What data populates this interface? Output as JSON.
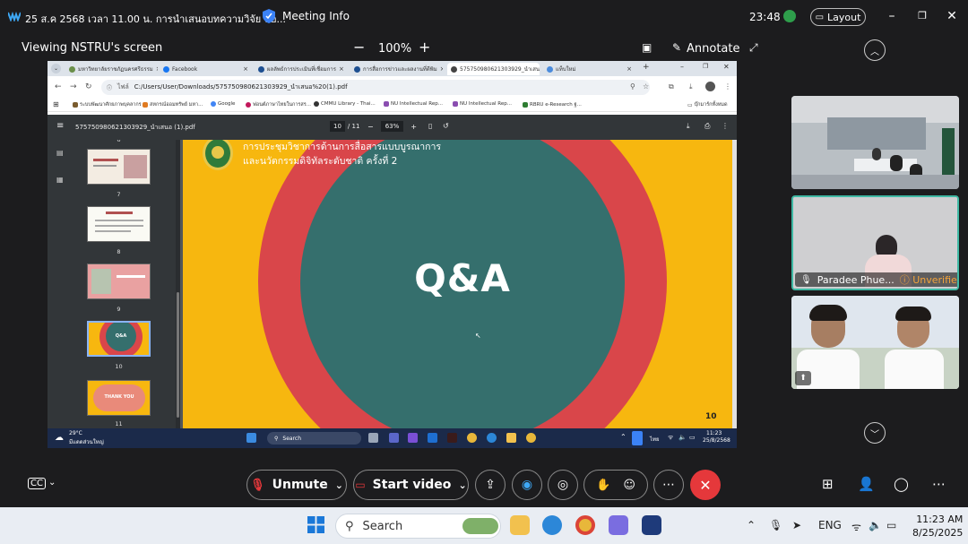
{
  "topbar": {
    "title": "25 ส.ค 2568 เวลา 11.00 น. การนำเสนอบทความวิจัย ห้อ...",
    "meeting_info": "Meeting Info",
    "clock": "23:48",
    "layout": "Layout"
  },
  "sharebar": {
    "label": "Viewing NSTRU's screen",
    "zoom": "100%",
    "annotate": "Annotate"
  },
  "shared": {
    "tabs": [
      {
        "label": "มหาวิทยาลัยราชภัฏนครศรีธรรม"
      },
      {
        "label": "Facebook"
      },
      {
        "label": "ผลลัพธ์การประเมินที่เชื่อมการ"
      },
      {
        "label": "การสื่อการข่าวและผลงานที่ตีพิม"
      },
      {
        "label": "575750980621303929_นำเสน"
      },
      {
        "label": "แท็บใหม่"
      }
    ],
    "url_prefix": "ไฟล์",
    "url": "C:/Users/User/Downloads/575750980621303929_นำเสนอ%20(1).pdf",
    "bookmarks": [
      "ระบบพัฒนาศักยภาพบุคลากร",
      "สหกรณ์ออมทรัพย์ มหา...",
      "Google",
      "ฟอนต์ภาษาไทยในการสร...",
      "CMMU Library - Thai...",
      "NU Intellectual Rep...",
      "NU Intellectual Rep...",
      "RBRU e-Research ฐ..."
    ],
    "bookmarks_all": "บุ๊กมาร์กทั้งหมด",
    "pdf": {
      "filename": "575750980621303929_นำเสนอ (1).pdf",
      "page_current": "10",
      "page_total": "/ 11",
      "zoom": "63%",
      "thumb_labels": [
        "6",
        "7",
        "8",
        "9",
        "10",
        "11"
      ],
      "thumb_texts": {
        "t10": "Q&A",
        "t11": "THANK YOU"
      }
    },
    "slide": {
      "header_line1": "การประชุมวิชาการด้านการสื่อสารแบบบูรณาการ",
      "header_line2": "และนวัตกรรมดิจิทัลระดับชาติ ครั้งที่ 2",
      "main": "Q&A",
      "page_number": "10"
    },
    "inner_taskbar": {
      "weather_temp": "29°C",
      "weather_desc": "มีแดดส่วนใหญ่",
      "search": "Search",
      "lang": "ไทย",
      "time": "11:23",
      "date": "25/8/2568"
    }
  },
  "participants": [
    {
      "name": "",
      "tile": "room"
    },
    {
      "name": "Paradee Phue...",
      "status": "Unverified"
    },
    {
      "name": "",
      "tile": "two-students"
    }
  ],
  "controls": {
    "unmute": "Unmute",
    "start_video": "Start video"
  },
  "taskbar": {
    "search": "Search",
    "lang": "ENG",
    "time": "11:23 AM",
    "date": "8/25/2025"
  },
  "colors": {
    "slide_bg": "#f7b70f",
    "slide_ring": "#d9464a",
    "slide_center": "#356f6d",
    "end_button": "#e5383b",
    "active_speaker": "#3fb9a4",
    "unverified": "#f4a43a"
  }
}
